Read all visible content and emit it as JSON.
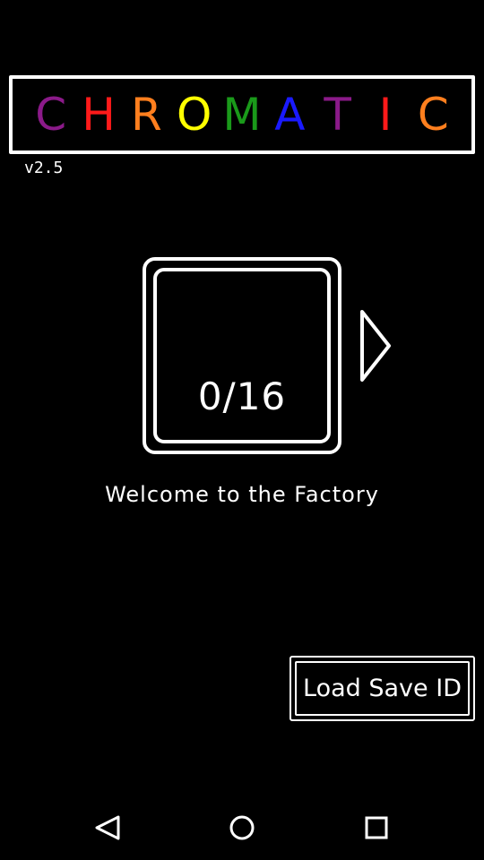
{
  "title": {
    "letters": [
      {
        "char": "C",
        "color": "#8b1a89"
      },
      {
        "char": "H",
        "color": "#ff1a1a"
      },
      {
        "char": "R",
        "color": "#ff7f1e"
      },
      {
        "char": "O",
        "color": "#ffff00"
      },
      {
        "char": "M",
        "color": "#1a9a1a"
      },
      {
        "char": "A",
        "color": "#1a1aff"
      },
      {
        "char": "T",
        "color": "#8b1a89"
      },
      {
        "char": "I",
        "color": "#ff1a1a"
      },
      {
        "char": "C",
        "color": "#ff7f1e"
      }
    ]
  },
  "version": "v2.5",
  "level": {
    "count_text": "0/16"
  },
  "welcome_text": "Welcome to the Factory",
  "load_button_label": "Load Save ID",
  "icons": {
    "next": "play-arrow-outline-icon",
    "nav_back": "back-triangle-icon",
    "nav_home": "home-circle-icon",
    "nav_recents": "recents-square-icon"
  },
  "colors": {
    "background": "#000000",
    "foreground": "#ffffff"
  }
}
